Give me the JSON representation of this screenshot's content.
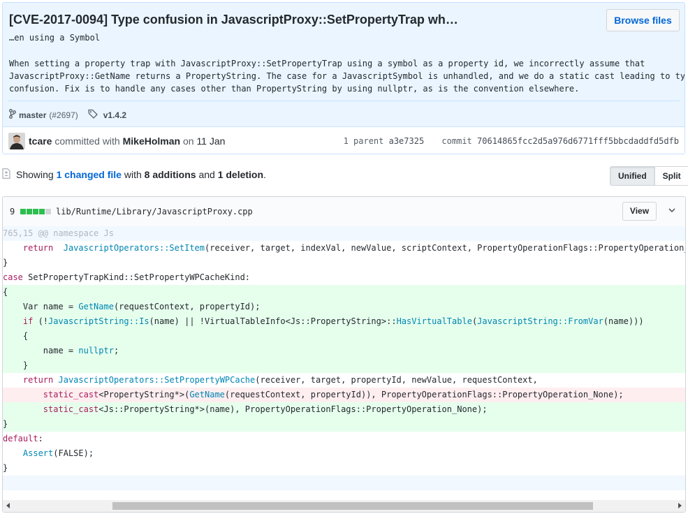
{
  "commit": {
    "title": "[CVE-2017-0094] Type confusion in JavascriptProxy::SetPropertyTrap wh…",
    "title_continuation": "…en using a Symbol",
    "browse_label": "Browse files",
    "description": "When setting a property trap with JavascriptProxy::SetPropertyTrap using a symbol as a property id, we incorrectly assume that\nJavascriptProxy::GetName returns a PropertyString. The case for a JavascriptSymbol is unhandled, and we do a static cast leading to type\nconfusion. Fix is to handle any cases other than PropertyString by using nullptr, as is the convention elsewhere.",
    "branch": "master",
    "pr": "(#2697)",
    "tag": "v1.4.2",
    "author": "tcare",
    "committed_with": "committed with",
    "coauthor": "MikeHolman",
    "date_prefix": "on",
    "date": "11 Jan",
    "parent_label": "1 parent",
    "parent_sha": "a3e7325",
    "commit_label": "commit",
    "commit_sha": "70614865fcc2d5a976d6771fff5bbcdaddfd5dfb"
  },
  "summary": {
    "showing": "Showing",
    "changed_files": "1 changed file",
    "with": "with",
    "additions": "8 additions",
    "and": "and",
    "deletions": "1 deletion",
    "period": "."
  },
  "view_toggle": {
    "unified": "Unified",
    "split": "Split"
  },
  "file": {
    "change_count": "9",
    "path": "lib/Runtime/Library/JavascriptProxy.cpp",
    "view_label": "View",
    "stat_colors": [
      "#2cbe4e",
      "#2cbe4e",
      "#2cbe4e",
      "#2cbe4e",
      "#d1d5da"
    ]
  },
  "diff_lines": [
    {
      "type": "hunk",
      "text": "765,15 @@ namespace Js"
    },
    {
      "type": "ctx",
      "text": "    return  JavascriptOperators::SetItem(receiver, target, indexVal, newValue, scriptContext, PropertyOperationFlags::PropertyOperation_None"
    },
    {
      "type": "ctx",
      "text": "}"
    },
    {
      "type": "ctx",
      "text": "case SetPropertyTrapKind::SetPropertyWPCacheKind:"
    },
    {
      "type": "add",
      "text": "{"
    },
    {
      "type": "add",
      "text": "    Var name = GetName(requestContext, propertyId);"
    },
    {
      "type": "add",
      "text": "    if (!JavascriptString::Is(name) || !VirtualTableInfo<Js::PropertyString>::HasVirtualTable(JavascriptString::FromVar(name)))"
    },
    {
      "type": "add",
      "text": "    {"
    },
    {
      "type": "add",
      "text": "        name = nullptr;"
    },
    {
      "type": "add",
      "text": "    }"
    },
    {
      "type": "ctx",
      "text": "    return JavascriptOperators::SetPropertyWPCache(receiver, target, propertyId, newValue, requestContext,"
    },
    {
      "type": "del",
      "text": "        static_cast<PropertyString*>(GetName(requestContext, propertyId)), PropertyOperationFlags::PropertyOperation_None);"
    },
    {
      "type": "add",
      "text": "        static_cast<Js::PropertyString*>(name), PropertyOperationFlags::PropertyOperation_None);"
    },
    {
      "type": "add",
      "text": "}"
    },
    {
      "type": "ctx",
      "text": "default:"
    },
    {
      "type": "ctx",
      "text": "    Assert(FALSE);"
    },
    {
      "type": "ctx",
      "text": "}"
    },
    {
      "type": "end",
      "text": ""
    }
  ]
}
